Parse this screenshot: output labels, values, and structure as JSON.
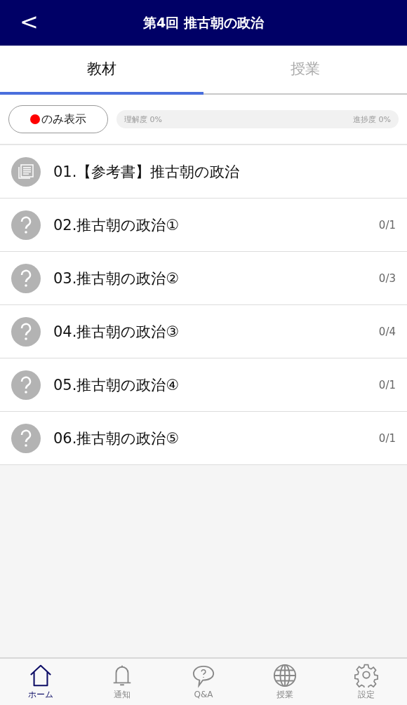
{
  "header": {
    "back": "<",
    "title": "第4回 推古朝の政治"
  },
  "tabs": [
    {
      "label": "教材",
      "selected": true
    },
    {
      "label": "授業",
      "selected": false
    }
  ],
  "filter": {
    "label": "のみ表示",
    "on": false
  },
  "progress": {
    "understanding": "理解度 0%",
    "progress": "進捗度 0%"
  },
  "items": [
    {
      "kind": "reference",
      "title": "01.【参考書】推古朝の政治"
    },
    {
      "kind": "quiz",
      "title": "02.推古朝の政治①",
      "count": "0/1"
    },
    {
      "kind": "quiz",
      "title": "03.推古朝の政治②",
      "count": "0/3"
    },
    {
      "kind": "quiz",
      "title": "04.推古朝の政治③",
      "count": "0/4"
    },
    {
      "kind": "quiz",
      "title": "05.推古朝の政治④",
      "count": "0/1"
    },
    {
      "kind": "quiz",
      "title": "06.推古朝の政治⑤",
      "count": "0/1"
    }
  ],
  "nav": [
    {
      "kind": "home",
      "label": "ホーム",
      "selected": true
    },
    {
      "kind": "bell",
      "label": "通知",
      "selected": false
    },
    {
      "kind": "qa",
      "label": "Q&A",
      "selected": false
    },
    {
      "kind": "globe",
      "label": "授業",
      "selected": false
    },
    {
      "kind": "gear",
      "label": "設定",
      "selected": false
    }
  ]
}
